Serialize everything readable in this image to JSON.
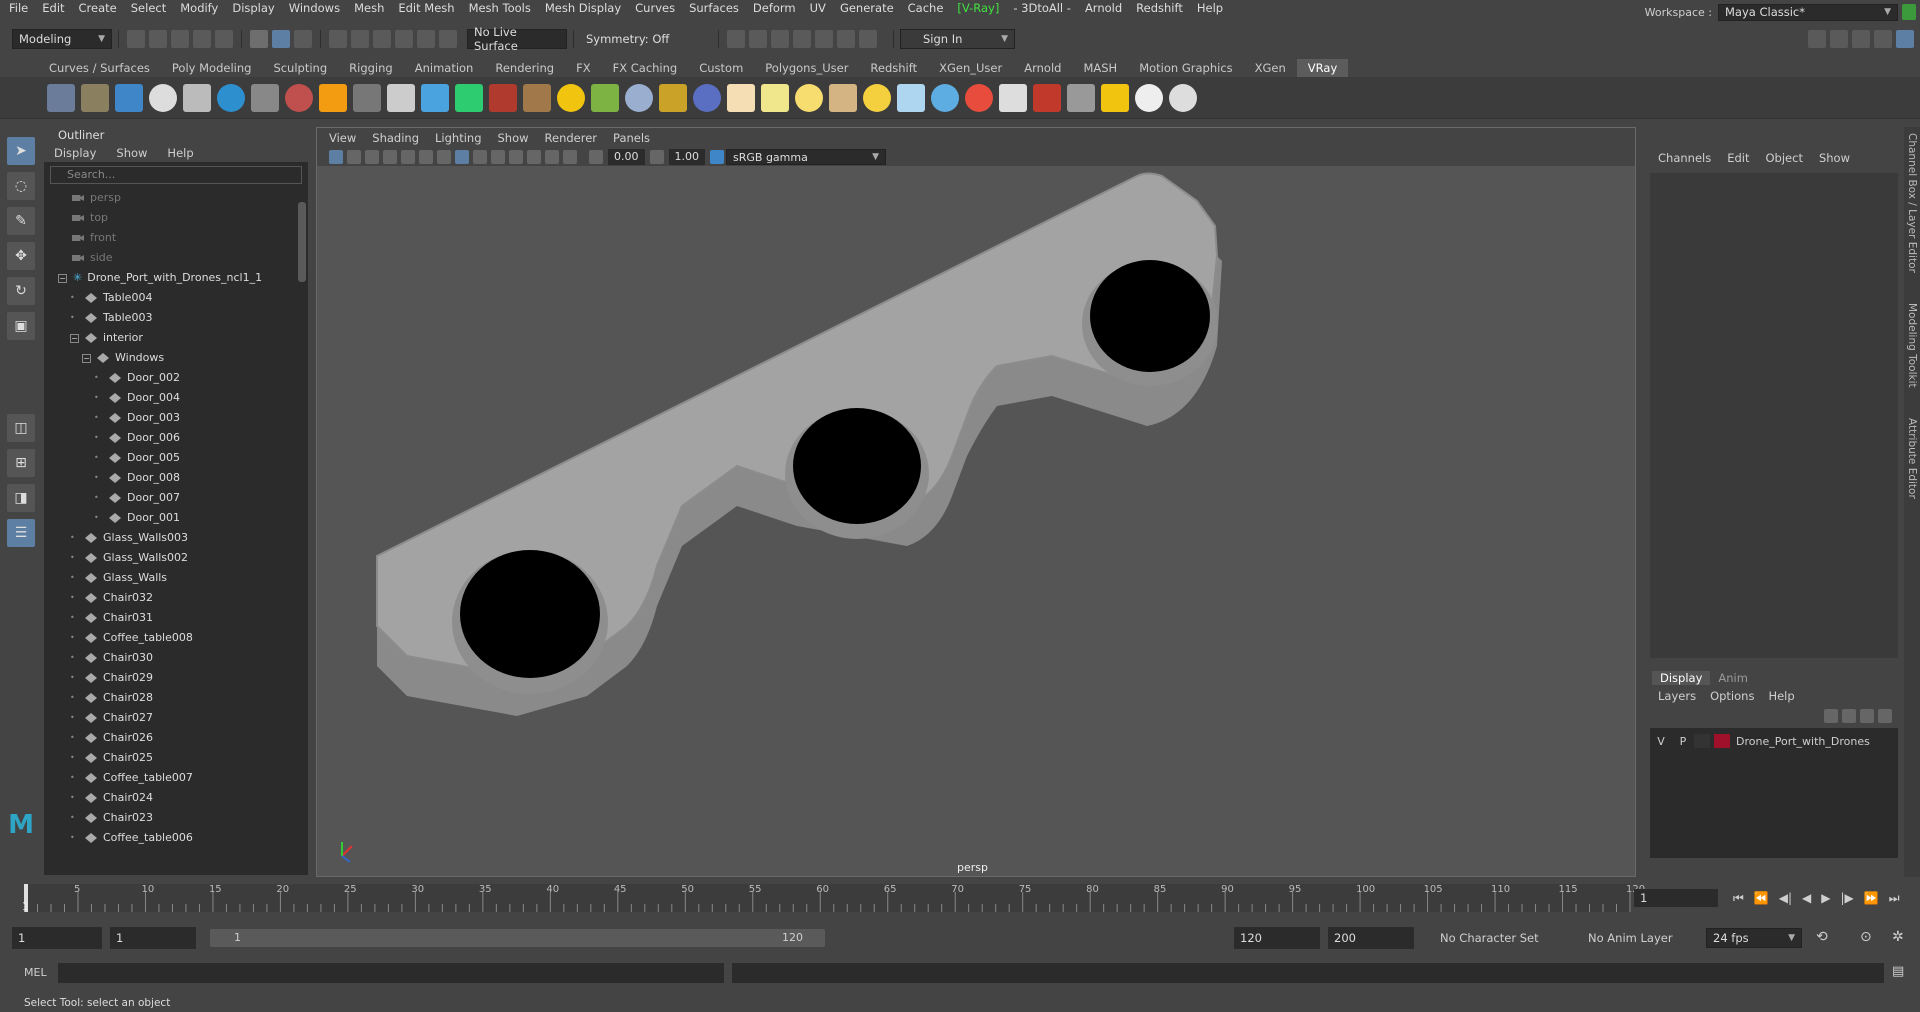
{
  "menubar": {
    "items": [
      "File",
      "Edit",
      "Create",
      "Select",
      "Modify",
      "Display",
      "Windows",
      "Mesh",
      "Edit Mesh",
      "Mesh Tools",
      "Mesh Display",
      "Curves",
      "Surfaces",
      "Deform",
      "UV",
      "Generate",
      "Cache"
    ],
    "vray": "[V-Ray]",
    "items2": [
      "- 3DtoAll -",
      "Arnold",
      "Redshift",
      "Help"
    ],
    "workspace_label": "Workspace :",
    "workspace_value": "Maya Classic*"
  },
  "toolbar": {
    "mode": "Modeling",
    "live_surface": "No Live Surface",
    "symmetry": "Symmetry: Off",
    "sign_in": "Sign In"
  },
  "shelf": {
    "tabs": [
      "Curves / Surfaces",
      "Poly Modeling",
      "Sculpting",
      "Rigging",
      "Animation",
      "Rendering",
      "FX",
      "FX Caching",
      "Custom",
      "Polygons_User",
      "Redshift",
      "XGen_User",
      "Arnold",
      "MASH",
      "Motion Graphics",
      "XGen",
      "VRay"
    ],
    "active_tab": "VRay"
  },
  "outliner": {
    "title": "Outliner",
    "menu": [
      "Display",
      "Show",
      "Help"
    ],
    "search_placeholder": "Search...",
    "cameras": [
      "persp",
      "top",
      "front",
      "side"
    ],
    "root": "Drone_Port_with_Drones_ncl1_1",
    "rows": [
      {
        "label": "Table004",
        "depth": 1
      },
      {
        "label": "Table003",
        "depth": 1
      },
      {
        "label": "interior",
        "depth": 1,
        "expanded": true
      },
      {
        "label": "Windows",
        "depth": 2,
        "expanded": true
      },
      {
        "label": "Door_002",
        "depth": 3
      },
      {
        "label": "Door_004",
        "depth": 3
      },
      {
        "label": "Door_003",
        "depth": 3
      },
      {
        "label": "Door_006",
        "depth": 3
      },
      {
        "label": "Door_005",
        "depth": 3
      },
      {
        "label": "Door_008",
        "depth": 3
      },
      {
        "label": "Door_007",
        "depth": 3
      },
      {
        "label": "Door_001",
        "depth": 3
      },
      {
        "label": "Glass_Walls003",
        "depth": 1
      },
      {
        "label": "Glass_Walls002",
        "depth": 1
      },
      {
        "label": "Glass_Walls",
        "depth": 1
      },
      {
        "label": "Chair032",
        "depth": 1
      },
      {
        "label": "Chair031",
        "depth": 1
      },
      {
        "label": "Coffee_table008",
        "depth": 1
      },
      {
        "label": "Chair030",
        "depth": 1
      },
      {
        "label": "Chair029",
        "depth": 1
      },
      {
        "label": "Chair028",
        "depth": 1
      },
      {
        "label": "Chair027",
        "depth": 1
      },
      {
        "label": "Chair026",
        "depth": 1
      },
      {
        "label": "Chair025",
        "depth": 1
      },
      {
        "label": "Coffee_table007",
        "depth": 1
      },
      {
        "label": "Chair024",
        "depth": 1
      },
      {
        "label": "Chair023",
        "depth": 1
      },
      {
        "label": "Coffee_table006",
        "depth": 1
      }
    ]
  },
  "viewport": {
    "menu": [
      "View",
      "Shading",
      "Lighting",
      "Show",
      "Renderer",
      "Panels"
    ],
    "exposure": "0.00",
    "gamma": "1.00",
    "color_space": "sRGB gamma",
    "camera_label": "persp"
  },
  "channelbox": {
    "menu": [
      "Channels",
      "Edit",
      "Object",
      "Show"
    ],
    "layer_tabs": [
      "Display",
      "Anim"
    ],
    "layer_menu": [
      "Layers",
      "Options",
      "Help"
    ],
    "layer": {
      "v": "V",
      "p": "P",
      "name": "Drone_Port_with_Drones",
      "color": "#a0102a"
    },
    "side_tabs": [
      "Channel Box / Layer Editor",
      "Modeling Toolkit",
      "Attribute Editor"
    ]
  },
  "timeline": {
    "ticks": [
      "5",
      "10",
      "15",
      "20",
      "25",
      "30",
      "35",
      "40",
      "45",
      "50",
      "55",
      "60",
      "65",
      "70",
      "75",
      "80",
      "85",
      "90",
      "95",
      "100",
      "105",
      "110",
      "115",
      "120"
    ],
    "current_frame": "1",
    "start_marker": "1"
  },
  "range": {
    "start": "1",
    "inner_start": "1",
    "slider_start": "1",
    "slider_end": "120",
    "end": "120",
    "outer_end": "200",
    "character_set": "No Character Set",
    "anim_layer": "No Anim Layer",
    "fps": "24 fps"
  },
  "mel": {
    "label": "MEL"
  },
  "status": {
    "text": "Select Tool: select an object"
  }
}
